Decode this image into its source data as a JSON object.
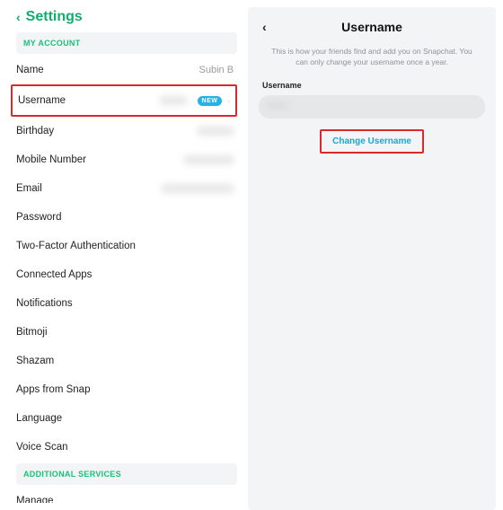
{
  "left": {
    "title": "Settings",
    "sections": [
      {
        "header": "MY ACCOUNT"
      },
      {
        "header": "ADDITIONAL SERVICES"
      }
    ],
    "rows": {
      "name": {
        "label": "Name",
        "value": "Subin B"
      },
      "username": {
        "label": "Username",
        "badge": "NEW"
      },
      "birthday": {
        "label": "Birthday"
      },
      "mobile": {
        "label": "Mobile Number"
      },
      "email": {
        "label": "Email"
      },
      "password": {
        "label": "Password"
      },
      "twofa": {
        "label": "Two-Factor Authentication"
      },
      "connected": {
        "label": "Connected Apps"
      },
      "notifications": {
        "label": "Notifications"
      },
      "bitmoji": {
        "label": "Bitmoji"
      },
      "shazam": {
        "label": "Shazam"
      },
      "appsfromsnap": {
        "label": "Apps from Snap"
      },
      "language": {
        "label": "Language"
      },
      "voicescan": {
        "label": "Voice Scan"
      },
      "manage": {
        "label": "Manage"
      }
    }
  },
  "right": {
    "title": "Username",
    "help": "This is how your friends find and add you on Snapchat. You can only change your username once a year.",
    "field_label": "Username",
    "redacted_value": "•••••",
    "change_button": "Change Username"
  }
}
